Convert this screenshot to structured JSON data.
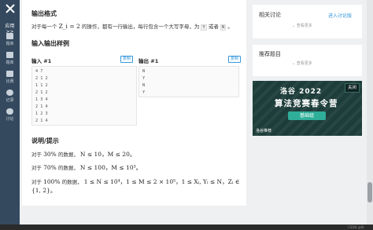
{
  "nav": {
    "apps_label": "应用 >>",
    "items": [
      {
        "label": "题库"
      },
      {
        "label": "题库"
      },
      {
        "label": "比赛"
      },
      {
        "label": "记录"
      },
      {
        "label": "讨论"
      }
    ]
  },
  "main": {
    "output_heading": "输出格式",
    "output_desc_prefix": "对于每一个",
    "output_desc_math": "Z_i = 2",
    "output_desc_mid": "的操作，都有一行输出，每行包含一个大写字母，为",
    "output_opt_y": "Y",
    "output_or": "或者",
    "output_opt_n": "N",
    "output_end": "。",
    "samples_heading": "输入输出样例",
    "input_label": "输入 #1",
    "output_label": "输出 #1",
    "copy_label": "复制",
    "input_lines": [
      "4 7",
      "2 1 2",
      "1 1 2",
      "2 1 2",
      "1 3 4",
      "2 1 4",
      "1 2 3",
      "2 1 4"
    ],
    "output_lines": [
      "N",
      "Y",
      "N",
      "Y"
    ],
    "notes_heading": "说明/提示",
    "note1_prefix": "对于",
    "note1_pct": "30%",
    "note1_mid": "的数据，",
    "note1_math": "N ≤ 10，M ≤ 20。",
    "note2_prefix": "对于",
    "note2_pct": "70%",
    "note2_mid": "的数据，",
    "note2_math": "N ≤ 100，M ≤ 10³。",
    "note3_prefix": "对于",
    "note3_pct": "100%",
    "note3_mid": "的数据，",
    "note3_math": "1 ≤ N ≤ 10⁴，1 ≤ M ≤ 2 × 10⁵，1 ≤ Xᵢ, Yᵢ ≤ N，Zᵢ ∈",
    "note3_math_line2": "{1, 2}。"
  },
  "side": {
    "discuss_title": "相关讨论",
    "discuss_link": "进入讨论版",
    "discuss_more": "⌄ 查看更多",
    "recommend_title": "推荐题目",
    "recommend_more": "⌄ 查看更多"
  },
  "ad": {
    "line1": "洛谷  2022",
    "line2": "算法竞赛春令营",
    "pill": "基础组",
    "close": "关闭",
    "brand": "洛谷推荐"
  },
  "footer": {
    "text": "CSDN @Kt"
  },
  "colors": {
    "nav_bg": "#34495e",
    "accent": "#3498db",
    "ad_bg": "#1d3d3a",
    "ad_pill": "#2fae9a"
  }
}
